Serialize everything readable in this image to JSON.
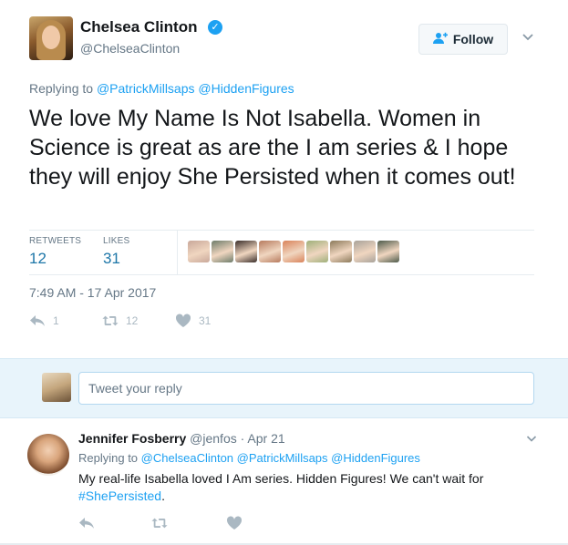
{
  "tweet": {
    "author_name": "Chelsea Clinton",
    "author_handle": "@ChelseaClinton",
    "follow_label": "Follow",
    "replying_prefix": "Replying to",
    "replying_mentions": [
      "@PatrickMillsaps",
      "@HiddenFigures"
    ],
    "text": "We love My Name Is Not Isabella. Women in Science is great as are the I am series & I hope they will enjoy She Persisted when it comes out!",
    "retweets_label": "RETWEETS",
    "retweets_count": "12",
    "likes_label": "LIKES",
    "likes_count": "31",
    "timestamp": "7:49 AM - 17 Apr 2017",
    "action_reply_count": "1",
    "action_retweet_count": "12",
    "action_like_count": "31",
    "liker_colors": [
      "#c9a89a",
      "#6d7c6a",
      "#3a2e2a",
      "#b77b5e",
      "#d9835a",
      "#9fb07a",
      "#8c7a5b",
      "#a8a29a",
      "#4d5a4a"
    ]
  },
  "reply_box": {
    "placeholder": "Tweet your reply"
  },
  "reply": {
    "author_name": "Jennifer Fosberry",
    "author_handle": "@jenfos",
    "separator": "·",
    "date": "Apr 21",
    "replying_prefix": "Replying to",
    "replying_mentions": [
      "@ChelseaClinton",
      "@PatrickMillsaps",
      "@HiddenFigures"
    ],
    "text": "My real-life Isabella loved I Am series. Hidden Figures! We can't wait for",
    "hashtag": "#ShePersisted",
    "text_end": "."
  },
  "icons": {
    "verified": "verified-badge-icon",
    "follow": "add-user-icon",
    "chevron": "chevron-down-icon",
    "reply": "reply-icon",
    "retweet": "retweet-icon",
    "like": "heart-icon"
  },
  "colors": {
    "accent": "#1da1f2",
    "muted": "#657786",
    "reply_box_bg": "#e8f4fb"
  }
}
